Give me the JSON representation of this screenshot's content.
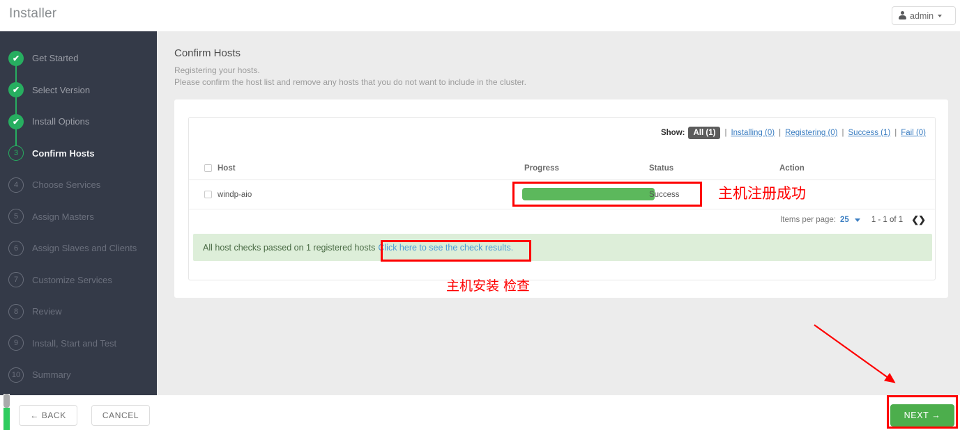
{
  "topbar": {
    "title": "Installer",
    "user_label": "admin",
    "user_icon": "person-icon",
    "caret_icon": "caret-down-icon"
  },
  "sidebar": {
    "steps": [
      {
        "num": "1",
        "label": "Get Started",
        "state": "done",
        "mark": "✔"
      },
      {
        "num": "2",
        "label": "Select Version",
        "state": "done",
        "mark": "✔"
      },
      {
        "num": "3",
        "label": "Install Options",
        "state": "done",
        "mark": "✔"
      },
      {
        "num": "3",
        "label": "Confirm Hosts",
        "state": "current",
        "mark": "3"
      },
      {
        "num": "4",
        "label": "Choose Services",
        "state": "todo",
        "mark": "4"
      },
      {
        "num": "5",
        "label": "Assign Masters",
        "state": "todo",
        "mark": "5"
      },
      {
        "num": "6",
        "label": "Assign Slaves and Clients",
        "state": "todo",
        "mark": "6"
      },
      {
        "num": "7",
        "label": "Customize Services",
        "state": "todo",
        "mark": "7"
      },
      {
        "num": "8",
        "label": "Review",
        "state": "todo",
        "mark": "8"
      },
      {
        "num": "9",
        "label": "Install, Start and Test",
        "state": "todo",
        "mark": "9"
      },
      {
        "num": "10",
        "label": "Summary",
        "state": "todo",
        "mark": "10"
      }
    ]
  },
  "main": {
    "title": "Confirm Hosts",
    "subtitle_line1": "Registering your hosts.",
    "subtitle_line2": "Please confirm the host list and remove any hosts that you do not want to include in the cluster.",
    "filter": {
      "show_label": "Show:",
      "all": "All (1)",
      "installing": "Installing (0)",
      "registering": "Registering (0)",
      "success": "Success (1)",
      "fail": "Fail (0)",
      "separator": "|"
    },
    "table": {
      "columns": [
        "Host",
        "Progress",
        "Status",
        "Action"
      ],
      "rows": [
        {
          "host": "windp-aio",
          "progress_percent": 100,
          "status": "Success",
          "action": ""
        }
      ]
    },
    "pager": {
      "items_per_page_label": "Items per page:",
      "items_per_page_value": "25",
      "range": "1 - 1 of 1",
      "prev_icon": "chevron-left-icon",
      "next_icon": "chevron-right-icon",
      "arrows": "❮❯"
    },
    "alert": {
      "message": "All host checks passed on 1 registered hosts",
      "link": "Click here to see the check results."
    }
  },
  "bottom": {
    "back": "← BACK",
    "cancel": "CANCEL",
    "next": "NEXT →"
  },
  "annotations": {
    "register_success": "主机注册成功",
    "host_install_check": "主机安装 检查",
    "color": "#fe0000"
  }
}
